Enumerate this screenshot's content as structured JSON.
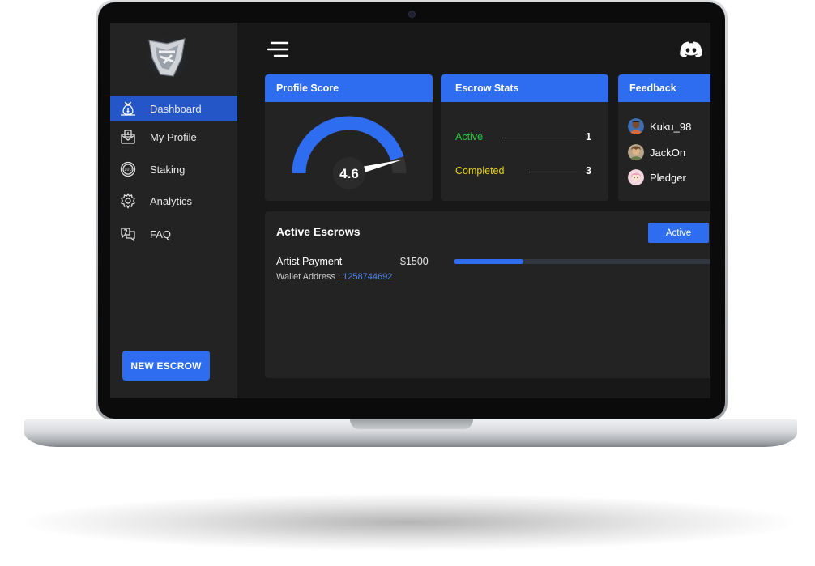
{
  "colors": {
    "accent": "#2f6df0",
    "sidebar_active": "#2556c8",
    "stat_active": "#27c93f",
    "stat_completed": "#e6d21a",
    "wallet_link": "#4f86f5"
  },
  "sidebar": {
    "logo_icon": "shield-crest-logo-icon",
    "items": [
      {
        "label": "Dashboard",
        "icon": "money-bag-icon",
        "active": true
      },
      {
        "label": "My Profile",
        "icon": "profile-envelope-icon",
        "active": false
      },
      {
        "label": "Staking",
        "icon": "coin-100-icon",
        "active": false
      },
      {
        "label": "Analytics",
        "icon": "gear-icon",
        "active": false
      },
      {
        "label": "FAQ",
        "icon": "faq-chat-icon",
        "active": false
      }
    ],
    "new_escrow_label": "NEW ESCROW"
  },
  "header": {
    "menu_icon": "hamburger-menu-icon",
    "discord_icon": "discord-icon"
  },
  "profile_score": {
    "title": "Profile Score",
    "score": "4.6",
    "score_value": 4.6,
    "score_max": 5
  },
  "escrow_stats": {
    "title": "Escrow Stats",
    "rows": [
      {
        "label": "Active",
        "value": "1"
      },
      {
        "label": "Completed",
        "value": "3"
      }
    ]
  },
  "feedback": {
    "title": "Feedback",
    "users": [
      {
        "name": "Kuku_98"
      },
      {
        "name": "JackOn"
      },
      {
        "name": "Pledger"
      }
    ]
  },
  "active_escrows": {
    "title": "Active Escrows",
    "filter_label": "Active",
    "items": [
      {
        "name": "Artist Payment",
        "amount": "$1500",
        "wallet_label": "Wallet Address : ",
        "wallet_address": "1258744692",
        "progress": 0.27
      }
    ]
  }
}
